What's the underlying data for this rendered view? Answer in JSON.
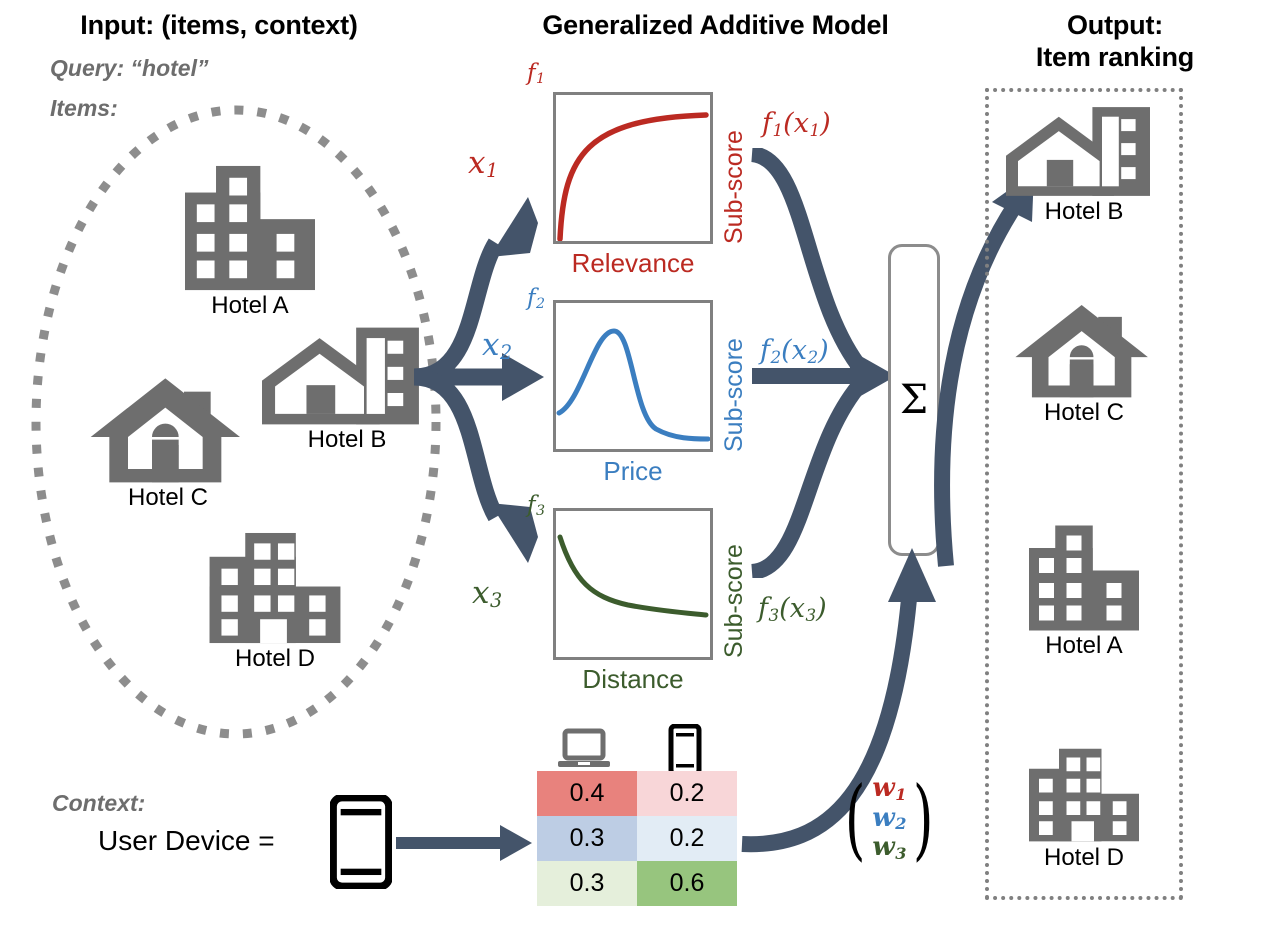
{
  "columns": {
    "input_title": "Input: (items, context)",
    "model_title": "Generalized Additive Model",
    "output_title_line1": "Output:",
    "output_title_line2": "Item ranking"
  },
  "input": {
    "query_label": "Query:",
    "query_value": "“hotel”",
    "items_label": "Items:",
    "context_label": "Context:",
    "user_device_label": "User Device =",
    "items": [
      {
        "name": "Hotel A",
        "icon": "building-icon"
      },
      {
        "name": "Hotel C",
        "icon": "house-icon"
      },
      {
        "name": "Hotel B",
        "icon": "house-building-icon"
      },
      {
        "name": "Hotel D",
        "icon": "building-door-icon"
      }
    ],
    "device_icon": "smartphone-icon"
  },
  "model": {
    "sigma_symbol": "Σ",
    "features": [
      {
        "f_label": "f",
        "f_sub": "1",
        "x_label": "x",
        "x_sub": "1",
        "fx_label": "f",
        "fx_sub": "1",
        "fx_arg": "x",
        "fx_arg_sub": "1",
        "x_axis": "Relevance",
        "y_axis": "Sub-score",
        "color": "#bb2a22",
        "shape": "concave-increasing"
      },
      {
        "f_label": "f",
        "f_sub": "2",
        "x_label": "x",
        "x_sub": "2",
        "fx_label": "f",
        "fx_sub": "2",
        "fx_arg": "x",
        "fx_arg_sub": "2",
        "x_axis": "Price",
        "y_axis": "Sub-score",
        "color": "#3b7ec0",
        "shape": "peak-then-decay"
      },
      {
        "f_label": "f",
        "f_sub": "3",
        "x_label": "x",
        "x_sub": "3",
        "fx_label": "f",
        "fx_sub": "3",
        "fx_arg": "x",
        "fx_arg_sub": "3",
        "x_axis": "Distance",
        "y_axis": "Sub-score",
        "color": "#3c5c2d",
        "shape": "decreasing"
      }
    ]
  },
  "weights_table": {
    "column_icons": [
      "laptop-icon",
      "smartphone-icon"
    ],
    "rows": [
      {
        "desktop": "0.4",
        "mobile": "0.2",
        "desktop_bg": "#e8827d",
        "mobile_bg": "#f8d6d8"
      },
      {
        "desktop": "0.3",
        "mobile": "0.2",
        "desktop_bg": "#bdcde4",
        "mobile_bg": "#e2ecf5"
      },
      {
        "desktop": "0.3",
        "mobile": "0.6",
        "desktop_bg": "#e5efdb",
        "mobile_bg": "#97c57e"
      }
    ],
    "vector": [
      {
        "label": "w",
        "sub": "1",
        "color": "#bb2a22"
      },
      {
        "label": "w",
        "sub": "2",
        "color": "#3b7ec0"
      },
      {
        "label": "w",
        "sub": "3",
        "color": "#3c5c2d"
      }
    ],
    "paren_left": "(",
    "paren_right": ")"
  },
  "output": {
    "ranking": [
      {
        "name": "Hotel B",
        "icon": "house-building-icon"
      },
      {
        "name": "Hotel C",
        "icon": "house-icon"
      },
      {
        "name": "Hotel A",
        "icon": "building-icon"
      },
      {
        "name": "Hotel D",
        "icon": "building-door-icon"
      }
    ]
  },
  "colors": {
    "navy_arrow": "#44546a",
    "gray_icon": "#6e6e6e",
    "gray_border": "#808080",
    "red": "#bb2a22",
    "blue": "#3b7ec0",
    "green": "#3c5c2d"
  }
}
